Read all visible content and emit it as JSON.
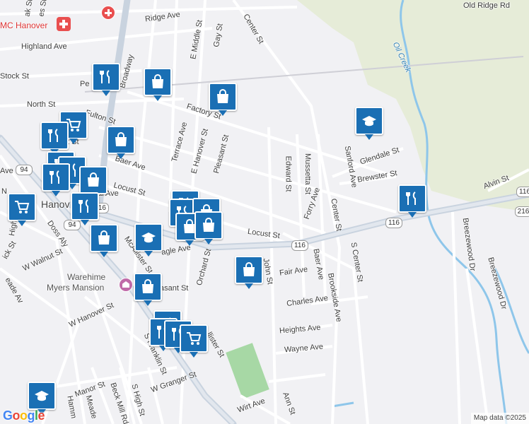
{
  "map": {
    "attribution": "Map data ©2025",
    "logo": "Google",
    "colors": {
      "land": "#f1f1f4",
      "park": "#e6ecd8",
      "water": "#8ec6ea",
      "minor_road": "#ffffff",
      "major_road": "#c9d3df",
      "rail": "#b8b8c0",
      "pin": "#1a6fb4"
    }
  },
  "labels": {
    "street_gay": "Gay St",
    "street_ridge": "Ridge Ave",
    "street_highland": "Highland Ave",
    "street_e_middle": "E Middle St",
    "street_center": "Center St",
    "street_old_ridge": "Old Ridge Rd",
    "water_oil_creek": "Oil Creek",
    "street_stock": "Stock St",
    "street_broadway": "Broadway",
    "street_north": "North St",
    "street_factory": "Factory St",
    "street_fulton": "Fulton St",
    "street_terrace": "Terrace Ave",
    "street_e_hanover": "E Hanover St",
    "street_pleasant": "Pleasant St",
    "street_baer_ave": "Baer Ave",
    "street_edward": "Edward St",
    "street_mussetta": "Mussetta St",
    "street_sanford": "Sanford Ave",
    "street_glendale": "Glendale St",
    "street_brewster": "Brewster St",
    "street_alvin": "Alvin St",
    "street_locust_w": "Locust St",
    "street_forry": "Forry Ave",
    "street_center_s": "Center St",
    "city_hanover": "Hanov",
    "street_york": "Yo",
    "street_locust_e": "Locust St",
    "street_doss": "Doss Aly",
    "street_mcallister": "McAllister St",
    "street_eagle": "agle Ave",
    "street_orchard": "Orchard St",
    "street_w_walnut": "W Walnut St",
    "street_john": "John St",
    "street_fair": "Fair Ave",
    "street_baer_st": "Baer Ave",
    "street_s_center": "S Center St",
    "street_breezewood_1": "Breezewood Dr",
    "street_breezewood_2": "Breezewood Dr",
    "street_high": "High St",
    "street_ick": "ick St",
    "street_eade": "eade Av",
    "poi_warehime": "Warehime",
    "poi_myers": "Myers Mansion",
    "street_pleasant_s": "asant St",
    "street_charles": "Charles Ave",
    "street_brookside": "Brookside Ave",
    "street_w_hanover": "W Hanover St",
    "street_heights": "Heights Ave",
    "street_llister": "llister St",
    "street_wayne": "Wayne Ave",
    "street_s_franklin": "S Franklin St",
    "street_w_granger": "W Granger St",
    "street_manor": "Manor St",
    "street_hamm": "Hamm",
    "street_meade": "Meade",
    "street_beck_mill": "Beck Mill Rd",
    "street_s_high": "S High St",
    "street_wirt": "Wirt Ave",
    "street_ann": "Ann St",
    "street_ave_left": "Ave",
    "street_al_ave": "al Ave",
    "street_n_left": "N",
    "street_pe": "Pe",
    "street_t_st": "t St",
    "street_es_st": "es St",
    "street_ak_st": "ak St",
    "poi_umc": "MC Hanover",
    "route_94_a": "94",
    "route_94_b": "94",
    "route_116_a": "116",
    "route_116_b": "116",
    "route_116_c": "116",
    "route_216": "216",
    "route_116_d": "116"
  }
}
